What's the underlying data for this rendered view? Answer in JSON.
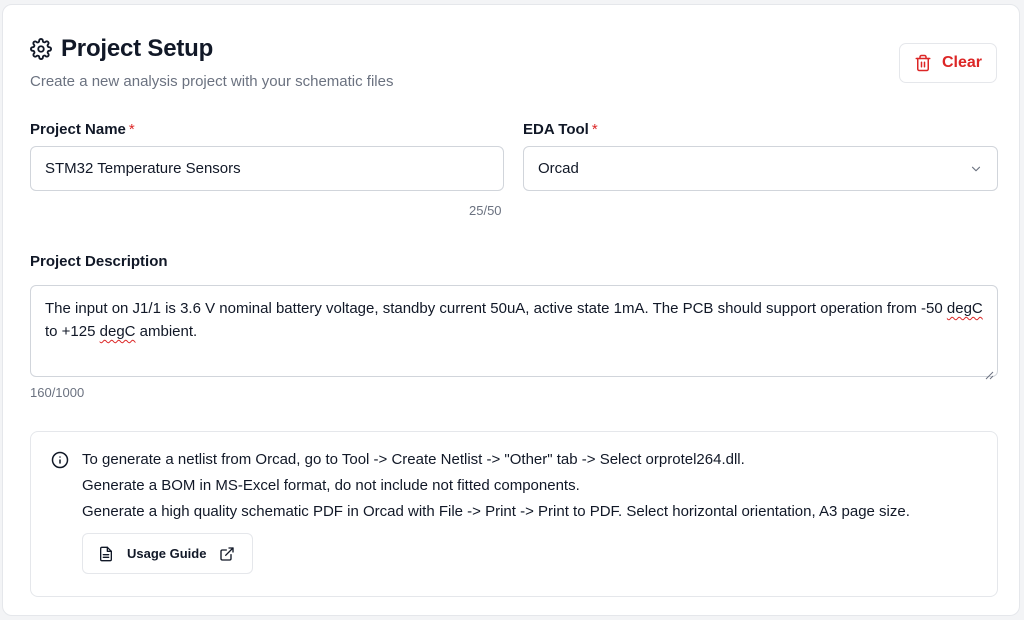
{
  "header": {
    "title": "Project Setup",
    "subtitle": "Create a new analysis project with your schematic files",
    "title_icon": "gear-icon",
    "clear_label": "Clear",
    "clear_icon": "trash-icon"
  },
  "form": {
    "project_name": {
      "label": "Project Name",
      "required_mark": "*",
      "value": "STM32 Temperature Sensors",
      "counter": "25/50"
    },
    "eda_tool": {
      "label": "EDA Tool",
      "required_mark": "*",
      "selected": "Orcad"
    },
    "description": {
      "label": "Project Description",
      "text_part1": "The input on J1/1 is 3.6 V nominal battery voltage, standby current 50uA, active state 1mA. The PCB should support operation from -50 ",
      "misspelled1": "degC",
      "text_part2": " to +125 ",
      "misspelled2": "degC",
      "text_part3": " ambient.",
      "counter": "160/1000"
    }
  },
  "info": {
    "icon": "info-circle-icon",
    "lines": [
      "To generate a netlist from Orcad, go to Tool -> Create Netlist -> \"Other\" tab -> Select orprotel264.dll.",
      "Generate a BOM in MS-Excel format, do not include not fitted components.",
      "Generate a high quality schematic PDF in Orcad with File -> Print -> Print to PDF. Select horizontal orientation, A3 page size."
    ],
    "guide_label": "Usage Guide",
    "guide_icon": "document-icon",
    "external_icon": "external-link-icon"
  },
  "colors": {
    "danger": "#dc2626",
    "border": "#d1d5db",
    "muted_text": "#6b7280"
  }
}
